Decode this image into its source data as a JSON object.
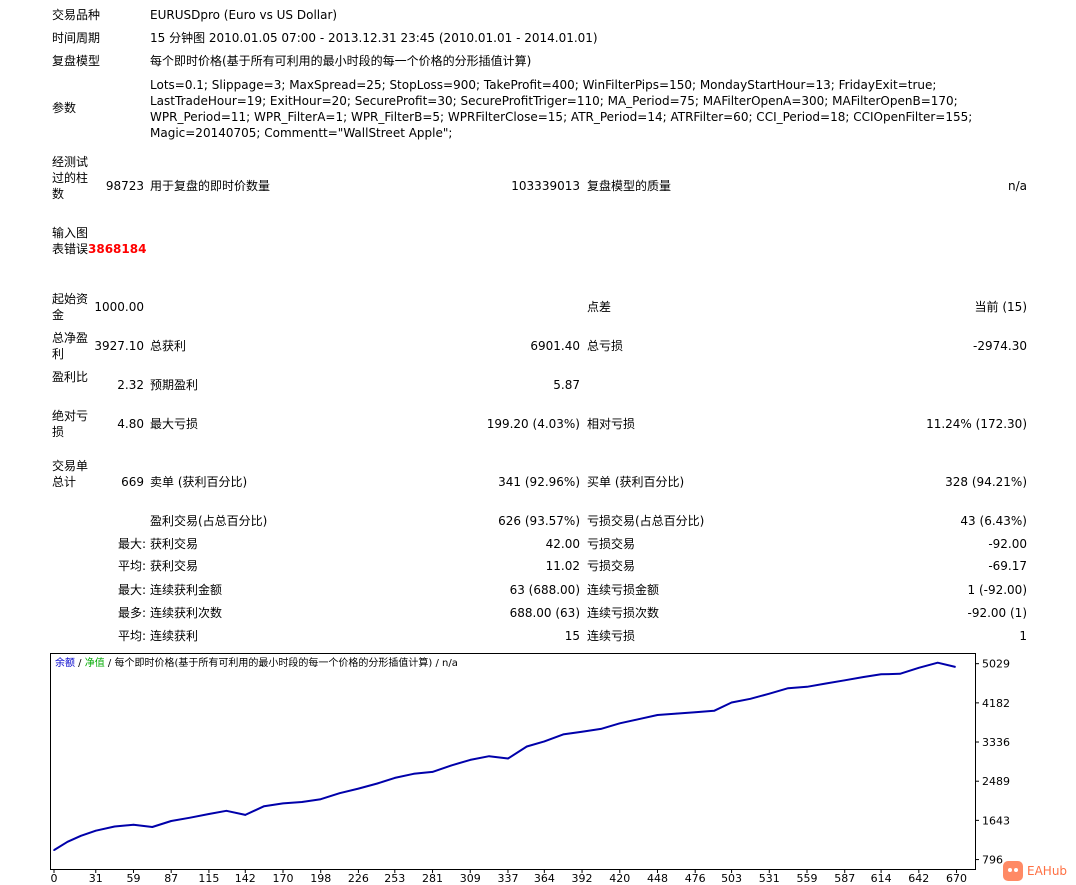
{
  "header": {
    "symbol_label": "交易品种",
    "symbol_value": "EURUSDpro (Euro vs US Dollar)",
    "period_label": "时间周期",
    "period_value": "15 分钟图 2010.01.05 07:00 - 2013.12.31 23:45 (2010.01.01 - 2014.01.01)",
    "model_label": "复盘模型",
    "model_value": "每个即时价格(基于所有可利用的最小时段的每一个价格的分形插值计算)",
    "params_label": "参数",
    "params_value": "Lots=0.1; Slippage=3; MaxSpread=25; StopLoss=900; TakeProfit=400; WinFilterPips=150; MondayStartHour=13; FridayExit=true; LastTradeHour=19; ExitHour=20; SecureProfit=30; SecureProfitTriger=110; MA_Period=75; MAFilterOpenA=300; MAFilterOpenB=170; WPR_Period=11; WPR_FilterA=1; WPR_FilterB=5; WPRFilterClose=15; ATR_Period=14; ATRFilter=60; CCI_Period=18; CCIOpenFilter=155; Magic=20140705; Commentt=\"WallStreet Apple\";"
  },
  "stats": {
    "bars_label": "经测试过的柱数",
    "bars_value": "98723",
    "ticks_label": "用于复盘的即时价数量",
    "ticks_value": "103339013",
    "quality_label": "复盘模型的质量",
    "quality_value": "n/a",
    "errors_label": "输入图表错误",
    "errors_value": "3868184",
    "deposit_label": "起始资金",
    "deposit_value": "1000.00",
    "spread_label": "点差",
    "spread_value": "当前 (15)",
    "net_label": "总净盈利",
    "net_value": "3927.10",
    "gross_profit_label": "总获利",
    "gross_profit_value": "6901.40",
    "gross_loss_label": "总亏损",
    "gross_loss_value": "-2974.30",
    "pf_label": "盈利比",
    "pf_value": "2.32",
    "expected_label": "预期盈利",
    "expected_value": "5.87",
    "abs_dd_label": "绝对亏损",
    "abs_dd_value": "4.80",
    "max_dd_label": "最大亏损",
    "max_dd_value": "199.20 (4.03%)",
    "rel_dd_label": "相对亏损",
    "rel_dd_value": "11.24% (172.30)",
    "trades_label": "交易单总计",
    "trades_value": "669",
    "short_label": "卖单 (获利百分比)",
    "short_value": "341 (92.96%)",
    "long_label": "买单 (获利百分比)",
    "long_value": "328 (94.21%)",
    "profit_trades_label": "盈利交易(占总百分比)",
    "profit_trades_value": "626 (93.57%)",
    "loss_trades_label": "亏损交易(占总百分比)",
    "loss_trades_value": "43 (6.43%)",
    "largest_label": "最大:",
    "largest_profit_label": "获利交易",
    "largest_profit_value": "42.00",
    "largest_loss_label": "亏损交易",
    "largest_loss_value": "-92.00",
    "average_label": "平均:",
    "average_profit_label": "获利交易",
    "average_profit_value": "11.02",
    "average_loss_label": "亏损交易",
    "average_loss_value": "-69.17",
    "max_label": "最大:",
    "max_cons_wins_label": "连续获利金额",
    "max_cons_wins_value": "63 (688.00)",
    "max_cons_losses_label": "连续亏损金额",
    "max_cons_losses_value": "1 (-92.00)",
    "most_label": "最多:",
    "most_cons_profit_label": "连续获利次数",
    "most_cons_profit_value": "688.00 (63)",
    "most_cons_loss_label": "连续亏损次数",
    "most_cons_loss_value": "-92.00 (1)",
    "avg_cons_label": "平均:",
    "avg_cons_wins_label": "连续获利",
    "avg_cons_wins_value": "15",
    "avg_cons_losses_label": "连续亏损",
    "avg_cons_losses_value": "1"
  },
  "chart_data": {
    "type": "line",
    "legend": {
      "balance": "余额",
      "separator1": " / ",
      "equity": "净值",
      "separator2": " / ",
      "model": "每个即时价格(基于所有可利用的最小时段的每一个价格的分形插值计算)",
      "separator3": " / ",
      "quality": "n/a"
    },
    "colors": {
      "balance": "#0000aa",
      "equity": "#00aa00",
      "legend_balance": "#0000cc",
      "legend_equity": "#00aa00",
      "axis_text": "#000000",
      "frame": "#000000"
    },
    "x_ticks": [
      0,
      31,
      59,
      87,
      115,
      142,
      170,
      198,
      226,
      253,
      281,
      309,
      337,
      364,
      392,
      420,
      448,
      476,
      503,
      531,
      559,
      587,
      614,
      642,
      670
    ],
    "y_ticks": [
      796,
      1643,
      2489,
      3336,
      4182,
      5029
    ],
    "xlim": [
      0,
      680
    ],
    "ylim": [
      700,
      5130
    ],
    "series": [
      {
        "x": [
          0,
          10,
          20,
          31,
          45,
          59,
          73,
          87,
          101,
          115,
          128,
          142,
          156,
          170,
          184,
          198,
          212,
          226,
          240,
          253,
          267,
          281,
          295,
          309,
          323,
          337,
          351,
          364,
          378,
          392,
          406,
          420,
          434,
          448,
          462,
          476,
          490,
          503,
          517,
          531,
          545,
          559,
          573,
          587,
          601,
          614,
          628,
          642,
          656,
          669
        ],
        "y": [
          1000,
          1180,
          1310,
          1420,
          1510,
          1550,
          1500,
          1630,
          1700,
          1780,
          1850,
          1760,
          1950,
          2010,
          2040,
          2100,
          2230,
          2330,
          2440,
          2560,
          2650,
          2690,
          2830,
          2950,
          3030,
          2980,
          3240,
          3350,
          3500,
          3560,
          3620,
          3740,
          3830,
          3920,
          3950,
          3980,
          4010,
          4190,
          4270,
          4380,
          4500,
          4530,
          4600,
          4670,
          4740,
          4800,
          4810,
          4940,
          5050,
          4960
        ]
      }
    ]
  },
  "watermark": {
    "text": "EAHub"
  }
}
